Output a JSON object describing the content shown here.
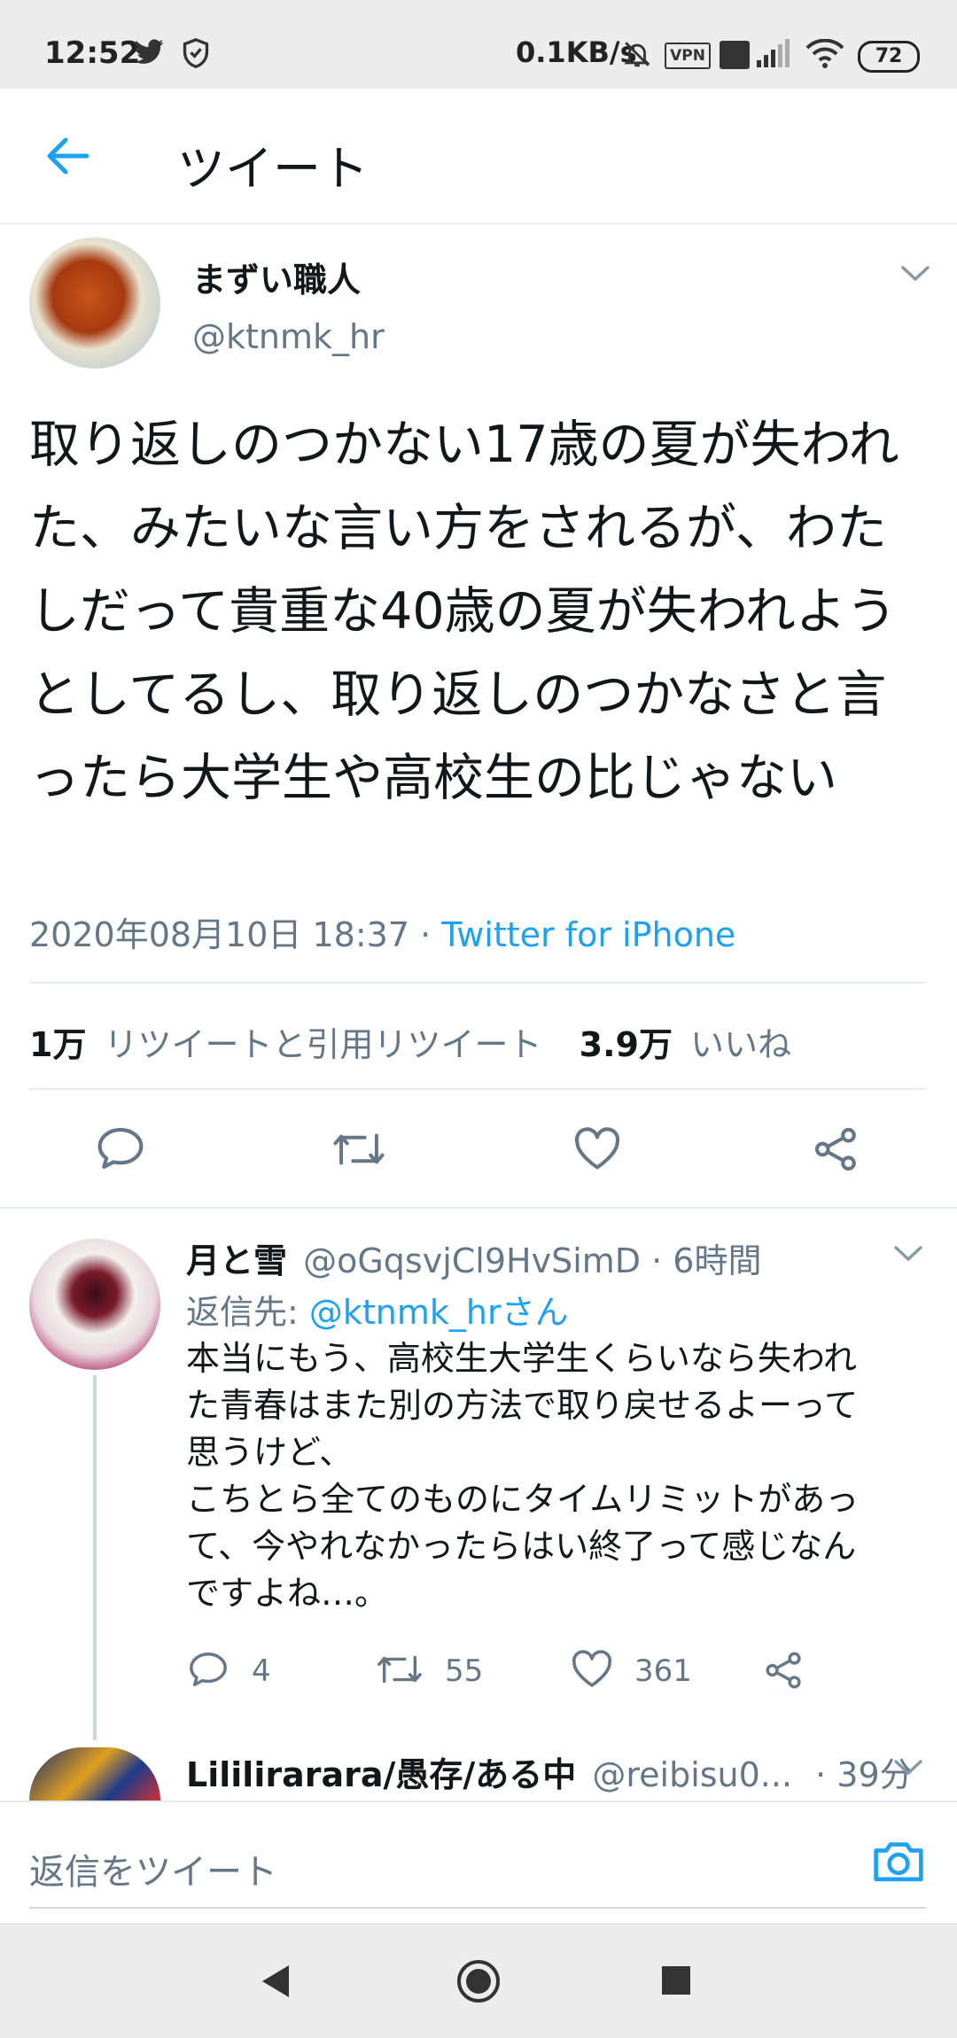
{
  "status_bar": {
    "time": "12:52",
    "network_speed": "0.1KB/s",
    "vpn": "VPN",
    "battery": "72"
  },
  "header": {
    "title": "ツイート"
  },
  "tweet": {
    "author_name": "まずい職人",
    "author_handle": "@ktnmk_hr",
    "text": "取り返しのつかない17歳の夏が失われた、みたいな言い方をされるが、わたしだって貴重な40歳の夏が失われようとしてるし、取り返しのつかなさと言ったら大学生や高校生の比じゃない",
    "timestamp": "2020年08月10日 18:37",
    "separator": " · ",
    "source": "Twitter for iPhone",
    "retweet_count": "1万",
    "retweet_label": "リツイートと引用リツイート",
    "like_count": "3.9万",
    "like_label": "いいね"
  },
  "reply": {
    "name": "月と雪",
    "handle_time": "@oGqsvjCl9HvSimD · 6時間",
    "reply_to_prefix": "返信先: ",
    "reply_to_handle": "@ktnmk_hrさん",
    "text_lines": [
      "本当にもう、高校生大学生くらいなら失われ",
      "た青春はまた別の方法で取り戻せるよーって",
      "思うけど、",
      "こちとら全てのものにタイムリミットがあっ",
      "て、今やれなかったらはい終了って感じなん",
      "ですよね…。"
    ],
    "reply_count": "4",
    "retweet_count": "55",
    "like_count": "361"
  },
  "reply2": {
    "name": "Lililirarara/愚存/ある中",
    "handle": "@reibisu0...",
    "time": " · 39分"
  },
  "compose": {
    "placeholder": "返信をツイート"
  },
  "colors": {
    "accent": "#1da1f2",
    "text": "#14171a",
    "secondary": "#657786"
  }
}
